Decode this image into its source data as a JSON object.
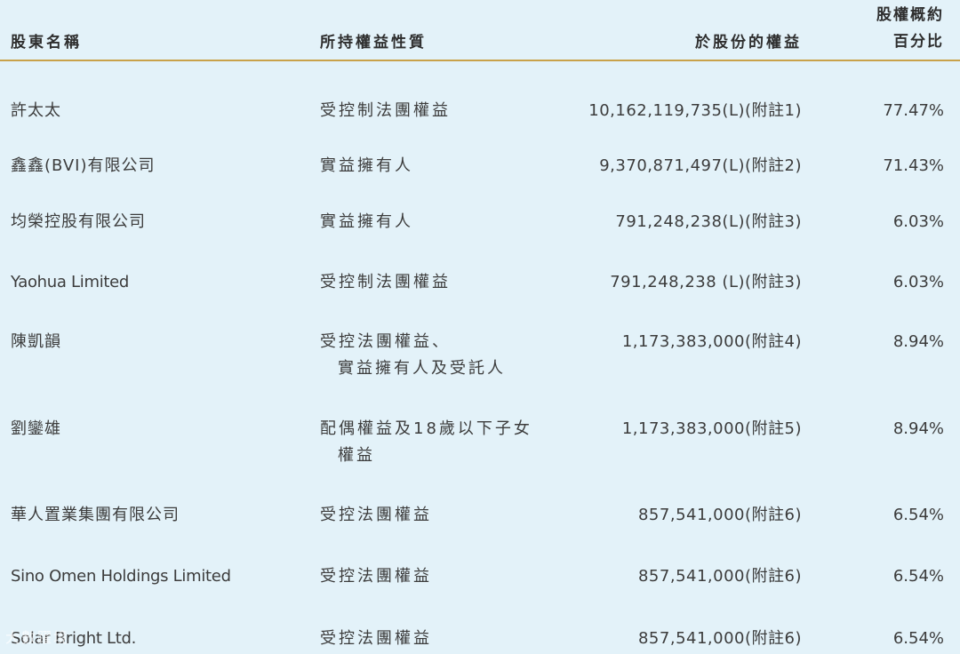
{
  "header": {
    "name": "股東名稱",
    "nature": "所持權益性質",
    "shares": "於股份的權益",
    "pct_line1": "股權概約",
    "pct_line2": "百分比"
  },
  "rows": [
    {
      "name": "許太太",
      "nature_line1": "受控制法團權益",
      "nature_line2": "",
      "shares": "10,162,119,735(L)(附註1)",
      "pct": "77.47%"
    },
    {
      "name": "鑫鑫(BVI)有限公司",
      "nature_line1": "實益擁有人",
      "nature_line2": "",
      "shares": "9,370,871,497(L)(附註2)",
      "pct": "71.43%"
    },
    {
      "name": "均榮控股有限公司",
      "nature_line1": "實益擁有人",
      "nature_line2": "",
      "shares": "791,248,238(L)(附註3)",
      "pct": "6.03%"
    },
    {
      "name": "Yaohua Limited",
      "nature_line1": "受控制法團權益",
      "nature_line2": "",
      "shares": "791,248,238 (L)(附註3)",
      "pct": "6.03%"
    },
    {
      "name": "陳凱韻",
      "nature_line1": "受控法團權益、",
      "nature_line2": "實益擁有人及受託人",
      "shares": "1,173,383,000(附註4)",
      "pct": "8.94%"
    },
    {
      "name": "劉鑾雄",
      "nature_line1": "配偶權益及18歲以下子女",
      "nature_line2": "權益",
      "shares": "1,173,383,000(附註5)",
      "pct": "8.94%"
    },
    {
      "name": "華人置業集團有限公司",
      "nature_line1": "受控法團權益",
      "nature_line2": "",
      "shares": "857,541,000(附註6)",
      "pct": "6.54%"
    },
    {
      "name": "Sino Omen Holdings Limited",
      "nature_line1": "受控法團權益",
      "nature_line2": "",
      "shares": "857,541,000(附註6)",
      "pct": "6.54%"
    },
    {
      "name": "Solar Bright Ltd.",
      "nature_line1": "受控法團權益",
      "nature_line2": "",
      "shares": "857,541,000(附註6)",
      "pct": "6.54%"
    }
  ],
  "watermark": "大數躍境"
}
